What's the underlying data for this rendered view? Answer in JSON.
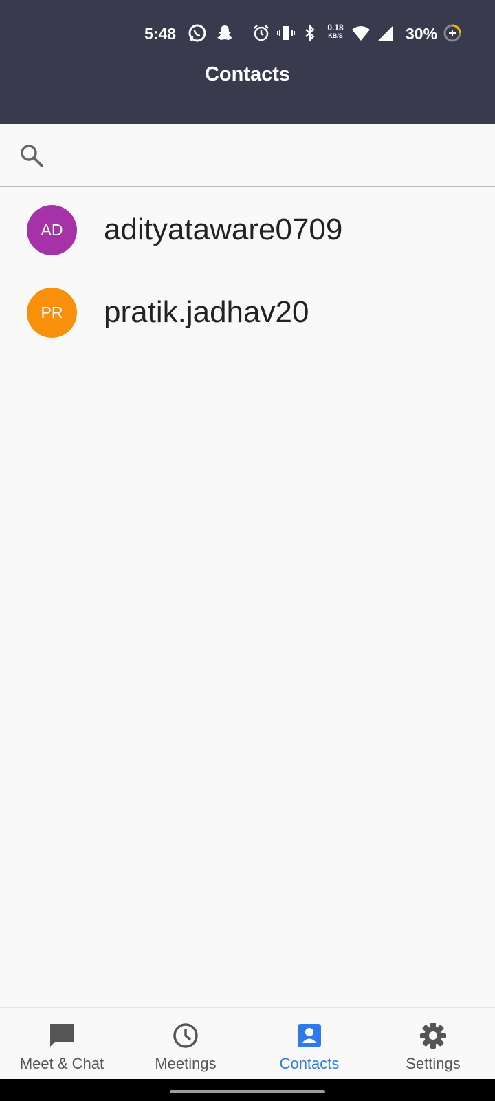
{
  "status_bar": {
    "time": "5:48",
    "speed_value": "0.18",
    "speed_unit": "KB/S",
    "battery": "30%",
    "icons": [
      "whatsapp-icon",
      "snapchat-icon",
      "alarm-icon",
      "vibrate-icon",
      "bluetooth-icon",
      "wifi-icon",
      "signal-icon",
      "battery-saver-icon"
    ]
  },
  "header": {
    "title": "Contacts"
  },
  "search": {
    "placeholder": "",
    "value": ""
  },
  "contacts": [
    {
      "initials": "AD",
      "name": "adityataware0709",
      "color": "#a532a8"
    },
    {
      "initials": "PR",
      "name": "pratik.jadhav20",
      "color": "#f8900c"
    }
  ],
  "bottom_nav": {
    "items": [
      {
        "label": "Meet & Chat",
        "icon": "chat-icon",
        "active": false
      },
      {
        "label": "Meetings",
        "icon": "clock-icon",
        "active": false
      },
      {
        "label": "Contacts",
        "icon": "contact-card-icon",
        "active": true
      },
      {
        "label": "Settings",
        "icon": "gear-icon",
        "active": false
      }
    ]
  },
  "colors": {
    "header_bg": "#393a4d",
    "accent": "#2d7bea",
    "nav_inactive": "#555555"
  }
}
